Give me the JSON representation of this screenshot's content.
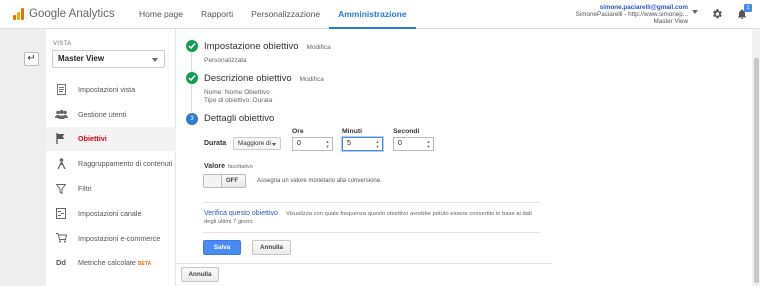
{
  "header": {
    "logo_text": "Google Analytics",
    "nav": [
      {
        "label": "Home page"
      },
      {
        "label": "Rapporti"
      },
      {
        "label": "Personalizzazione"
      },
      {
        "label": "Amministrazione"
      }
    ],
    "account": {
      "email": "simone.paciarelli@gmail.com",
      "property": "SimonePaciarelli - http://www.simonep...",
      "view": "Master View"
    },
    "notification_count": "1"
  },
  "sidebar": {
    "section_label": "VISTA",
    "view_select": "Master View",
    "items": [
      {
        "label": "Impostazioni vista",
        "icon": "document-icon"
      },
      {
        "label": "Gestione utenti",
        "icon": "users-icon"
      },
      {
        "label": "Obiettivi",
        "icon": "flag-icon"
      },
      {
        "label": "Raggruppamento di contenuti",
        "icon": "person-icon"
      },
      {
        "label": "Filtri",
        "icon": "filter-icon"
      },
      {
        "label": "Impostazioni canale",
        "icon": "channel-icon"
      },
      {
        "label": "Impostazioni e-commerce",
        "icon": "cart-icon"
      },
      {
        "label": "Metriche calcolate",
        "icon": "dd-icon",
        "badge": "BETA"
      }
    ]
  },
  "steps": {
    "step1": {
      "title": "Impostazione obiettivo",
      "modify": "Modifica",
      "summary": "Personalizzata"
    },
    "step2": {
      "title": "Descrizione obiettivo",
      "modify": "Modifica",
      "name_line": "Nome: Nome Obiettivo",
      "type_line": "Tipo di obiettivo: Durata"
    },
    "step3": {
      "number": "3",
      "title": "Dettagli obiettivo"
    }
  },
  "details": {
    "durata_label": "Durata",
    "operator": "Maggiore di",
    "hours_label": "Ore",
    "hours_value": "0",
    "minutes_label": "Minuti",
    "minutes_value": "5",
    "seconds_label": "Secondi",
    "seconds_value": "0",
    "valore_label": "Valore",
    "valore_optional": "facoltativo",
    "toggle_state": "OFF",
    "toggle_desc": "Assegna un valore monetario alla conversione.",
    "verify_link": "Verifica questo obiettivo",
    "verify_desc_1": "Visualizza con quale frequenza questo obiettivo avrebbe potuto essere convertito in base ai dati",
    "verify_desc_2": "degli ultimi 7 giorni.",
    "save": "Salva",
    "cancel": "Annulla"
  },
  "footer": {
    "cancel": "Annulla"
  },
  "colors": {
    "accent": "#2a7ad6",
    "active_menu": "#d0021b",
    "check": "#0f9d58",
    "primary_button": "#4a8af4"
  }
}
